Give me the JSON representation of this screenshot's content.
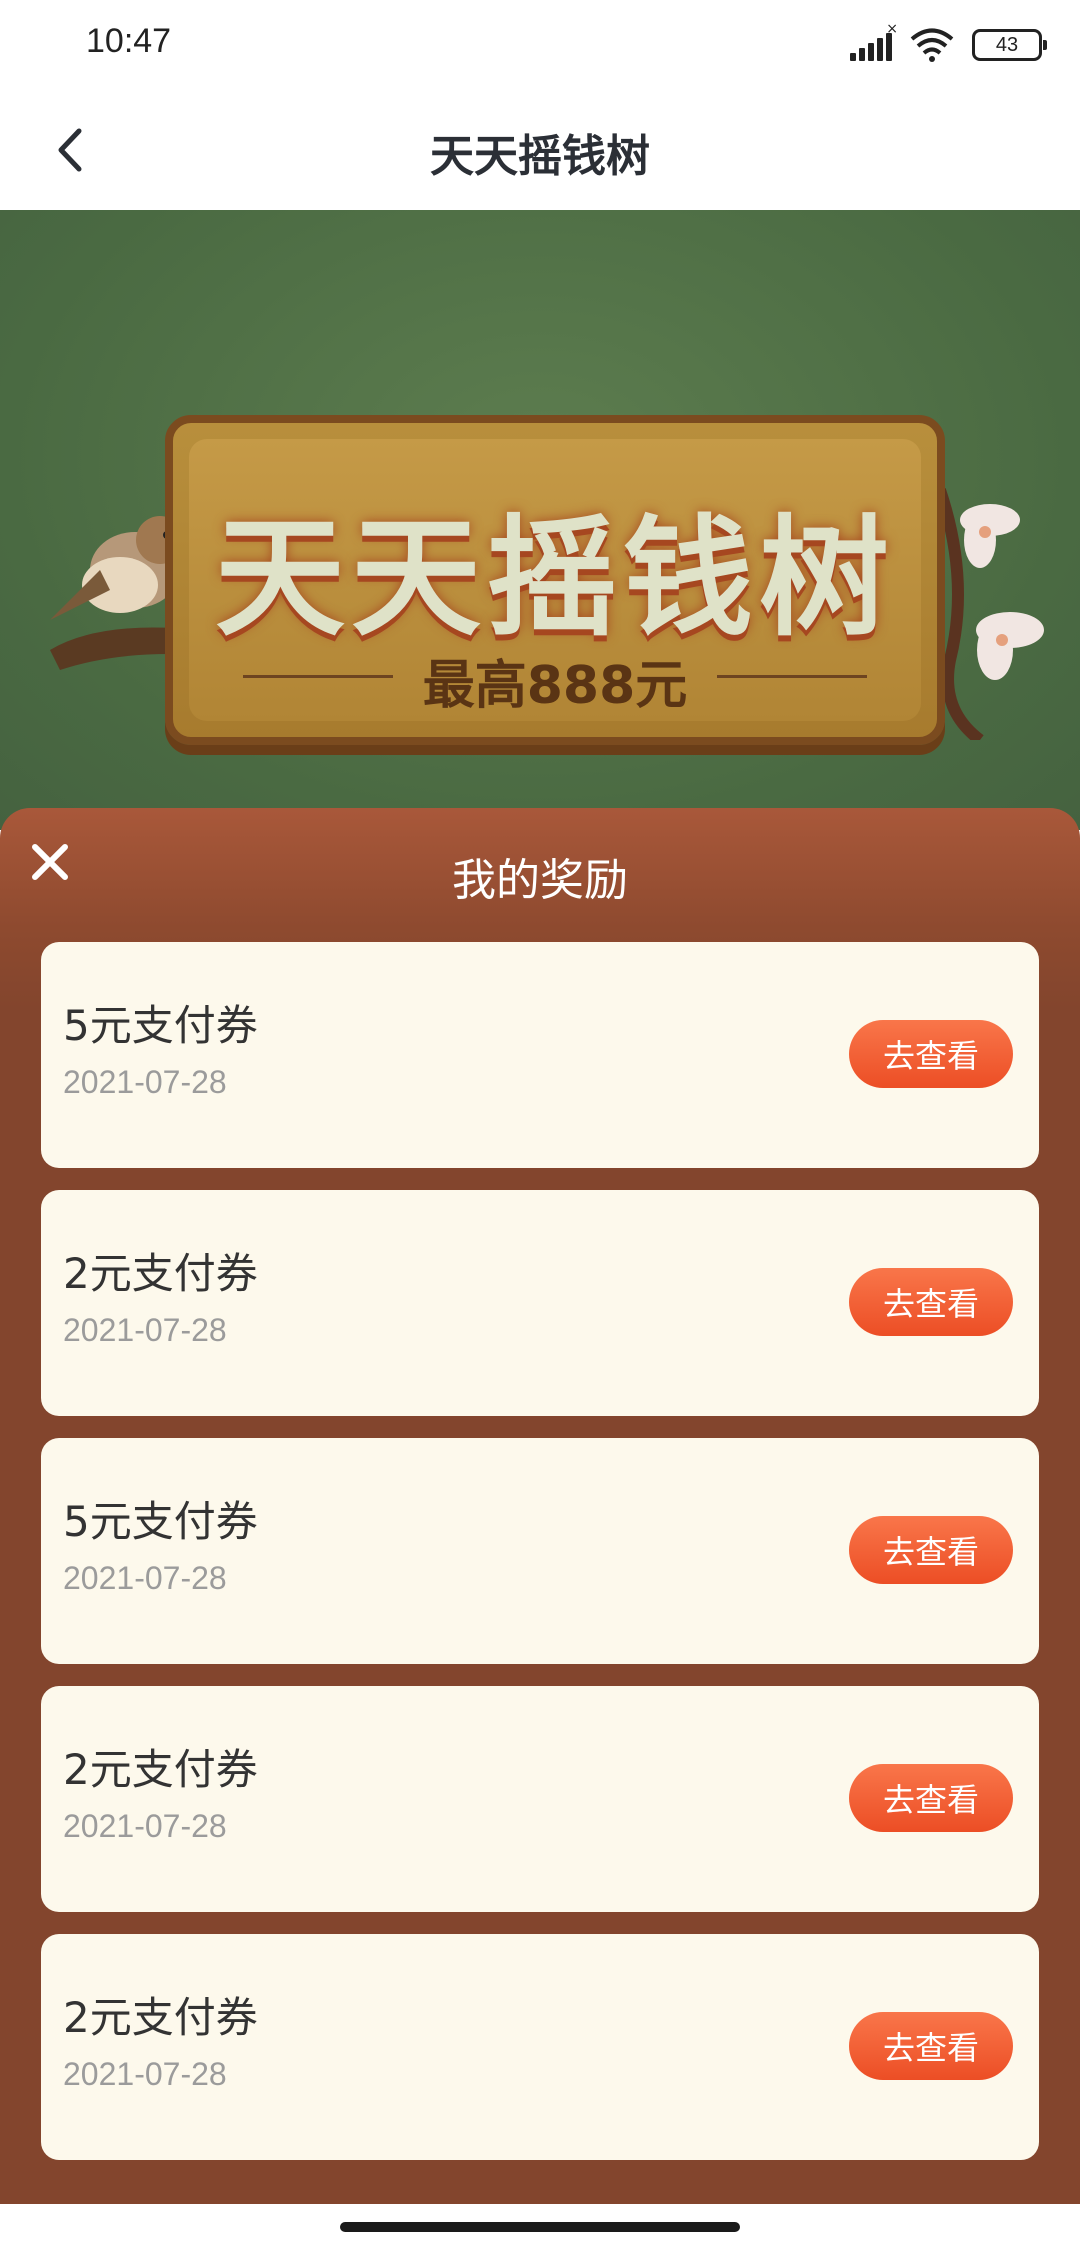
{
  "status_bar": {
    "time": "10:47",
    "battery": "43",
    "icons": [
      "signal-icon",
      "wifi-icon",
      "battery-icon"
    ]
  },
  "header": {
    "title": "天天摇钱树",
    "back_icon": "chevron-left-icon"
  },
  "banner": {
    "title": "天天摇钱树",
    "subtitle": "最高888元"
  },
  "rewards_sheet": {
    "title": "我的奖励",
    "close_icon": "close-icon",
    "items": [
      {
        "name": "5元支付券",
        "date": "2021-07-28",
        "button": "去查看"
      },
      {
        "name": "2元支付券",
        "date": "2021-07-28",
        "button": "去查看"
      },
      {
        "name": "5元支付券",
        "date": "2021-07-28",
        "button": "去查看"
      },
      {
        "name": "2元支付券",
        "date": "2021-07-28",
        "button": "去查看"
      },
      {
        "name": "2元支付券",
        "date": "2021-07-28",
        "button": "去查看"
      }
    ]
  },
  "colors": {
    "sheet_bg": "#83452d",
    "card_bg": "#fdf9ec",
    "button_accent": "#ec4e25",
    "banner_bg": "#4a6a42"
  }
}
